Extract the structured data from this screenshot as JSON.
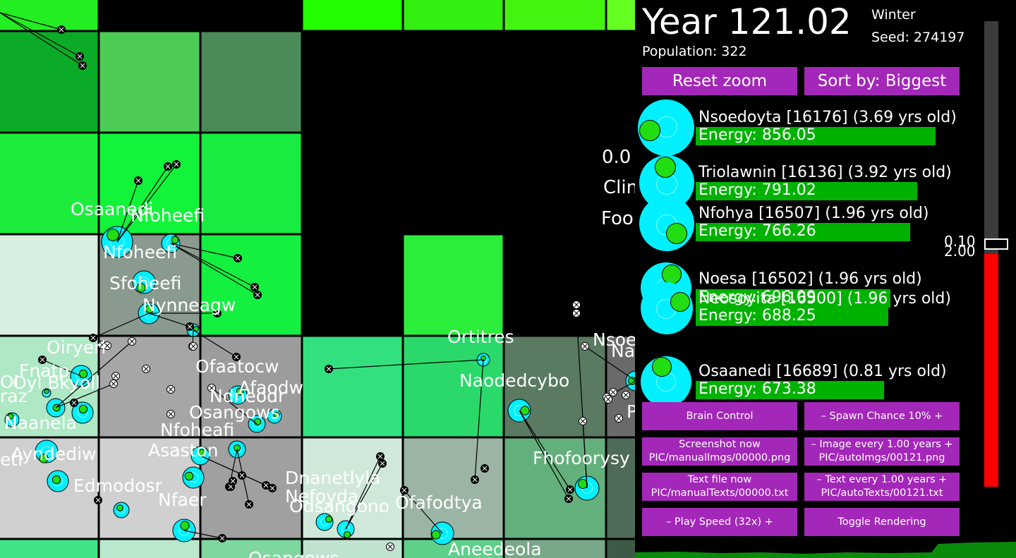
{
  "hud": {
    "year": "Year 121.02",
    "season": "Winter",
    "seed": "Seed: 274197",
    "population": "Population: 322"
  },
  "buttons": {
    "reset_zoom": "Reset zoom",
    "sort_by": "Sort by: Biggest",
    "brain_control": "Brain Control",
    "spawn_chance": "–   Spawn Chance 10%   +",
    "screenshot_line1": "Screenshot now",
    "screenshot_line2": "PIC/manualImgs/00000.png",
    "image_every_line1": "–   Image every 1.00 years   +",
    "image_every_line2": "PIC/autoImgs/00121.png",
    "textfile_line1": "Text file now",
    "textfile_line2": "PIC/manualTexts/00000.txt",
    "text_every_line1": "–   Text every 1.00 years   +",
    "text_every_line2": "PIC/autoTexts/00121.txt",
    "play_speed": "–    Play Speed (32x)    +",
    "toggle_rendering": "Toggle Rendering"
  },
  "leaderboard": [
    {
      "name": "Nsoedoyta [16176] (3.69 yrs old)",
      "energy": "Energy: 856.05",
      "energy_value": 856.05
    },
    {
      "name": "Triolawnin [16136] (3.92 yrs old)",
      "energy": "Energy: 791.02",
      "energy_value": 791.02
    },
    {
      "name": "Nfohya [16507] (1.96 yrs old)",
      "energy": "Energy: 766.26",
      "energy_value": 766.26
    },
    {
      "name": "Noesa [16502] (1.96 yrs old)",
      "energy": "Energy: 696.09",
      "energy_value": 696.09
    },
    {
      "name": "Neosoyita [16500] (1.96 yrs old)",
      "energy": "Energy: 688.25",
      "energy_value": 688.25
    },
    {
      "name": "Osaanedi [16689] (0.81 yrs old)",
      "energy": "Energy: 673.38",
      "energy_value": 673.38
    }
  ],
  "slider": {
    "label_top": "0.10",
    "label_bottom": "2.00",
    "fill_fraction": 0.5
  },
  "world": {
    "selected_info": [
      "0.0",
      "Clin",
      "Foo"
    ],
    "creature_labels": [
      "Osaanedi",
      "Nfoheefi",
      "Nfoheefi",
      "Sfoheefi",
      "Nynneagw",
      "Oiryeri",
      "Fnatp",
      "Oyl Bkyoll",
      "Naanela",
      "Ayndediw",
      "Ofaatocw",
      "Afaodw",
      "Ndneodr",
      "Osangows",
      "Nfoheafi",
      "Asaston",
      "Edmodosr",
      "Nfaer",
      "Dnanetlyla",
      "Nefoyda",
      "Odsangono",
      "Ofafodtya",
      "Aneedeola",
      "Osangows",
      "Ortitres",
      "Naodedcybo",
      "Fhofoorysy",
      "Nsoe",
      "Na",
      "P",
      "eti",
      "raz",
      "Ol"
    ]
  },
  "colors": {
    "button": "#a327b8",
    "creature": "#00f0ff",
    "energy_bar": "#00b200",
    "slider_fill": "#ff0000"
  }
}
